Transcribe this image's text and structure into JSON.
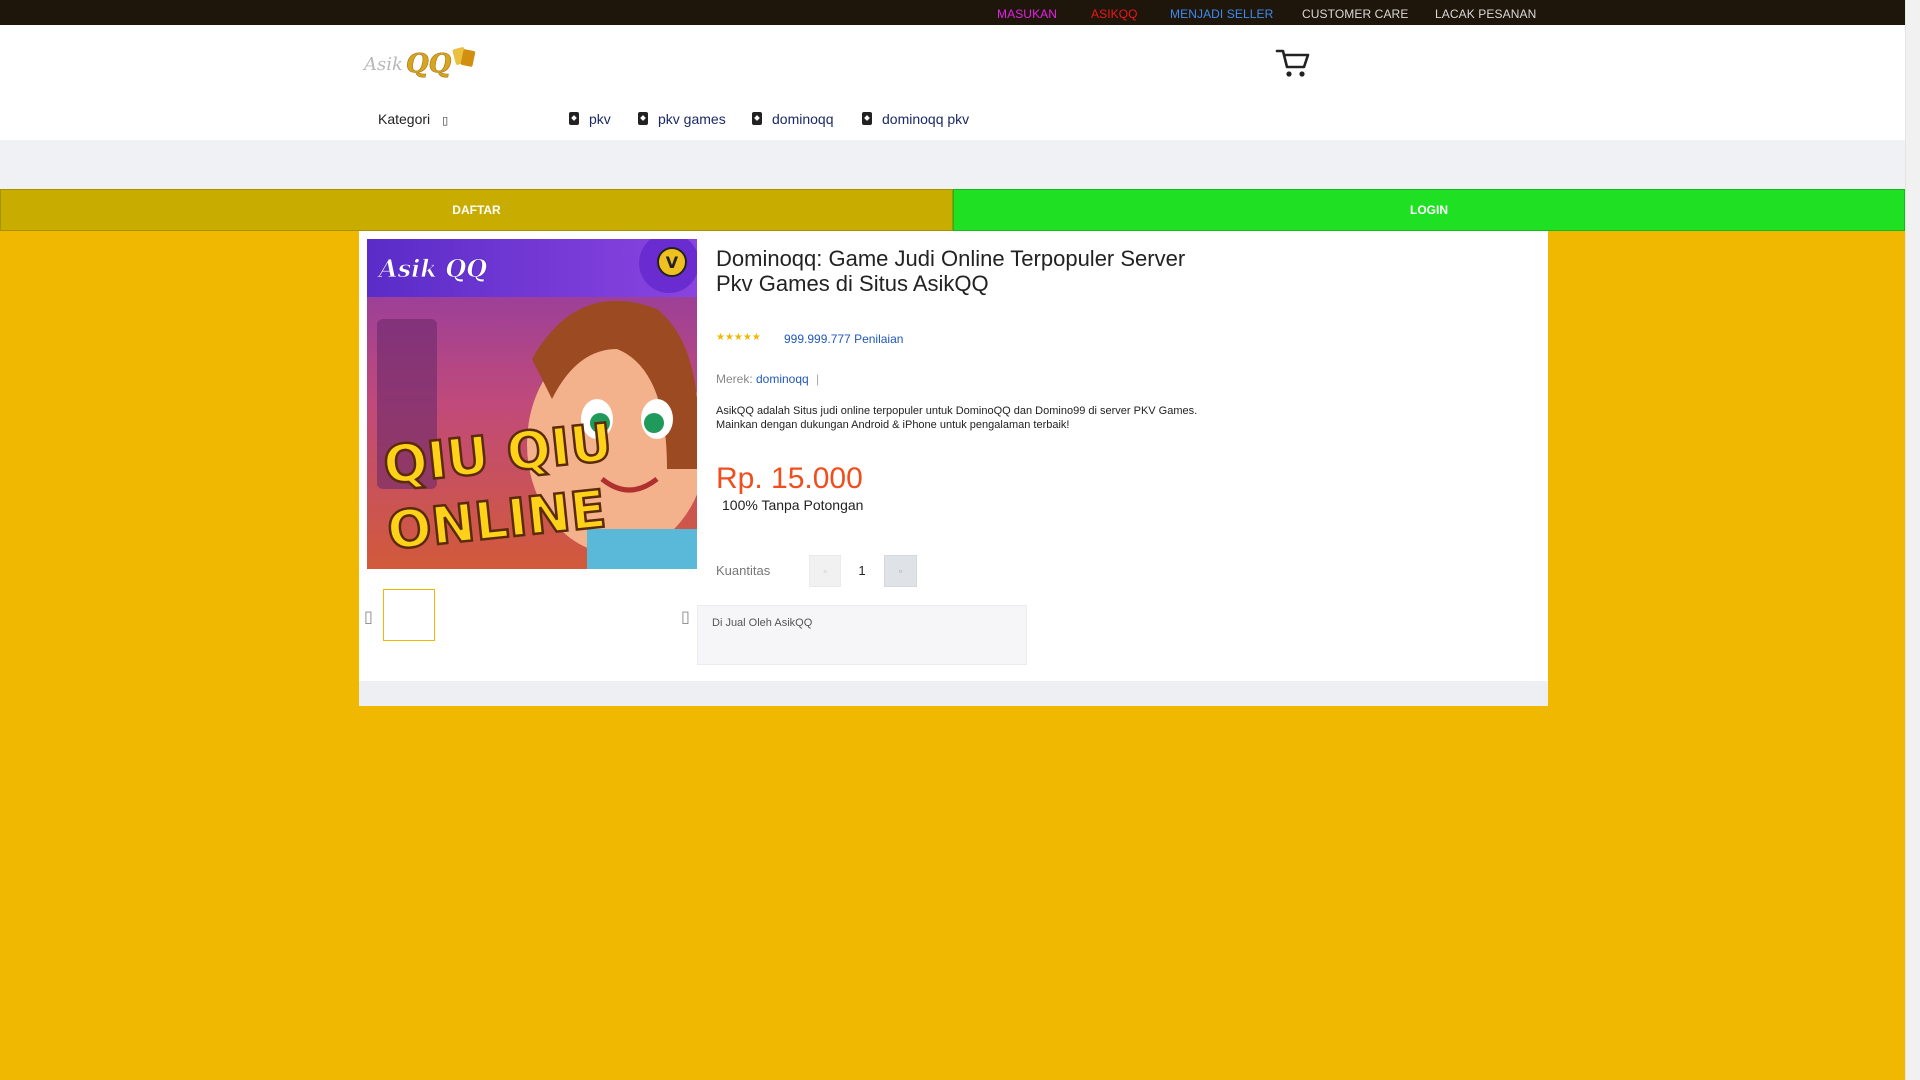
{
  "topbar": {
    "masukan": "MASUKAN",
    "asikqq": "ASIKQQ",
    "seller": "MENJADI SELLER",
    "care": "CUSTOMER CARE",
    "lacak": "LACAK PESANAN"
  },
  "header": {
    "logo_text": "Asik QQ",
    "kategori": "Kategori",
    "nav": [
      "pkv",
      "pkv games",
      "dominoqq",
      "dominoqq pkv"
    ]
  },
  "actions": {
    "daftar": "DAFTAR",
    "login": "LOGIN"
  },
  "product": {
    "image_brand": "Asik QQ",
    "image_title_line1": "QIU QIU",
    "image_title_line2": "ONLINE",
    "image_badge": "V",
    "title": "Dominoqq: Game Judi Online Terpopuler Server Pkv Games di Situs AsikQQ",
    "stars": "★★★★★",
    "rating_count": "999.999.777 Penilaian",
    "brand_label": "Merek:",
    "brand_value": "dominoqq",
    "brand_sep": "|",
    "description": "AsikQQ adalah Situs judi online terpopuler untuk DominoQQ dan Domino99 di server PKV Games. Mainkan dengan dukungan Android & iPhone untuk pengalaman terbaik!",
    "price": "Rp. 15.000",
    "discount_note": "100% Tanpa Potongan",
    "quantity_label": "Kuantitas",
    "quantity": "1",
    "seller_note": "Di Jual Oleh AsikQQ"
  },
  "colors": {
    "page_bg": "#f0b800",
    "daftar_bg": "#c8ad00",
    "login_bg": "#1fe022",
    "price": "#f04e1e",
    "link": "#2059b8"
  }
}
